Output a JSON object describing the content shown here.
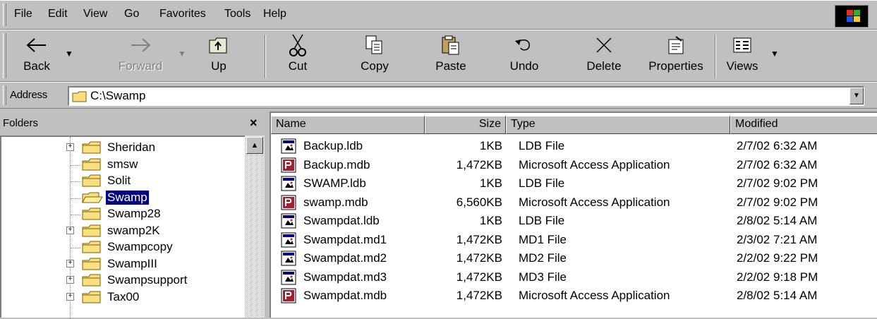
{
  "menu": [
    "File",
    "Edit",
    "View",
    "Go",
    "Favorites",
    "Tools",
    "Help"
  ],
  "toolbar": {
    "back": "Back",
    "forward": "Forward",
    "up": "Up",
    "cut": "Cut",
    "copy": "Copy",
    "paste": "Paste",
    "undo": "Undo",
    "delete": "Delete",
    "properties": "Properties",
    "views": "Views"
  },
  "address": {
    "label": "Address",
    "value": "C:\\Swamp"
  },
  "folders": {
    "title": "Folders",
    "close": "×",
    "items": [
      {
        "label": "Sheridan",
        "expandable": true,
        "selected": false
      },
      {
        "label": "smsw",
        "expandable": false,
        "selected": false
      },
      {
        "label": "Solit",
        "expandable": false,
        "selected": false
      },
      {
        "label": "Swamp",
        "expandable": false,
        "selected": true
      },
      {
        "label": "Swamp28",
        "expandable": false,
        "selected": false
      },
      {
        "label": "swamp2K",
        "expandable": true,
        "selected": false
      },
      {
        "label": "Swampcopy",
        "expandable": false,
        "selected": false
      },
      {
        "label": "SwampIII",
        "expandable": true,
        "selected": false
      },
      {
        "label": "Swampsupport",
        "expandable": true,
        "selected": false
      },
      {
        "label": "Tax00",
        "expandable": true,
        "selected": false
      }
    ]
  },
  "file_list": {
    "columns": {
      "name": "Name",
      "size": "Size",
      "type": "Type",
      "modified": "Modified"
    },
    "rows": [
      {
        "icon": "ldb-file-icon",
        "name": "Backup.ldb",
        "size": "1KB",
        "type": "LDB File",
        "modified": "2/7/02 6:32 AM"
      },
      {
        "icon": "access-app-icon",
        "name": "Backup.mdb",
        "size": "1,472KB",
        "type": "Microsoft Access Application",
        "modified": "2/7/02 6:32 AM"
      },
      {
        "icon": "ldb-file-icon",
        "name": "SWAMP.ldb",
        "size": "1KB",
        "type": "LDB File",
        "modified": "2/7/02 9:02 PM"
      },
      {
        "icon": "access-app-icon",
        "name": "swamp.mdb",
        "size": "6,560KB",
        "type": "Microsoft Access Application",
        "modified": "2/7/02 9:02 PM"
      },
      {
        "icon": "ldb-file-icon",
        "name": "Swampdat.ldb",
        "size": "1KB",
        "type": "LDB File",
        "modified": "2/8/02 5:14 AM"
      },
      {
        "icon": "ldb-file-icon",
        "name": "Swampdat.md1",
        "size": "1,472KB",
        "type": "MD1 File",
        "modified": "2/3/02 7:21 AM"
      },
      {
        "icon": "ldb-file-icon",
        "name": "Swampdat.md2",
        "size": "1,472KB",
        "type": "MD2 File",
        "modified": "2/2/02 9:22 PM"
      },
      {
        "icon": "ldb-file-icon",
        "name": "Swampdat.md3",
        "size": "1,472KB",
        "type": "MD3 File",
        "modified": "2/2/02 9:18 PM"
      },
      {
        "icon": "access-app-icon",
        "name": "Swampdat.mdb",
        "size": "1,472KB",
        "type": "Microsoft Access Application",
        "modified": "2/8/02 5:14 AM"
      }
    ]
  }
}
